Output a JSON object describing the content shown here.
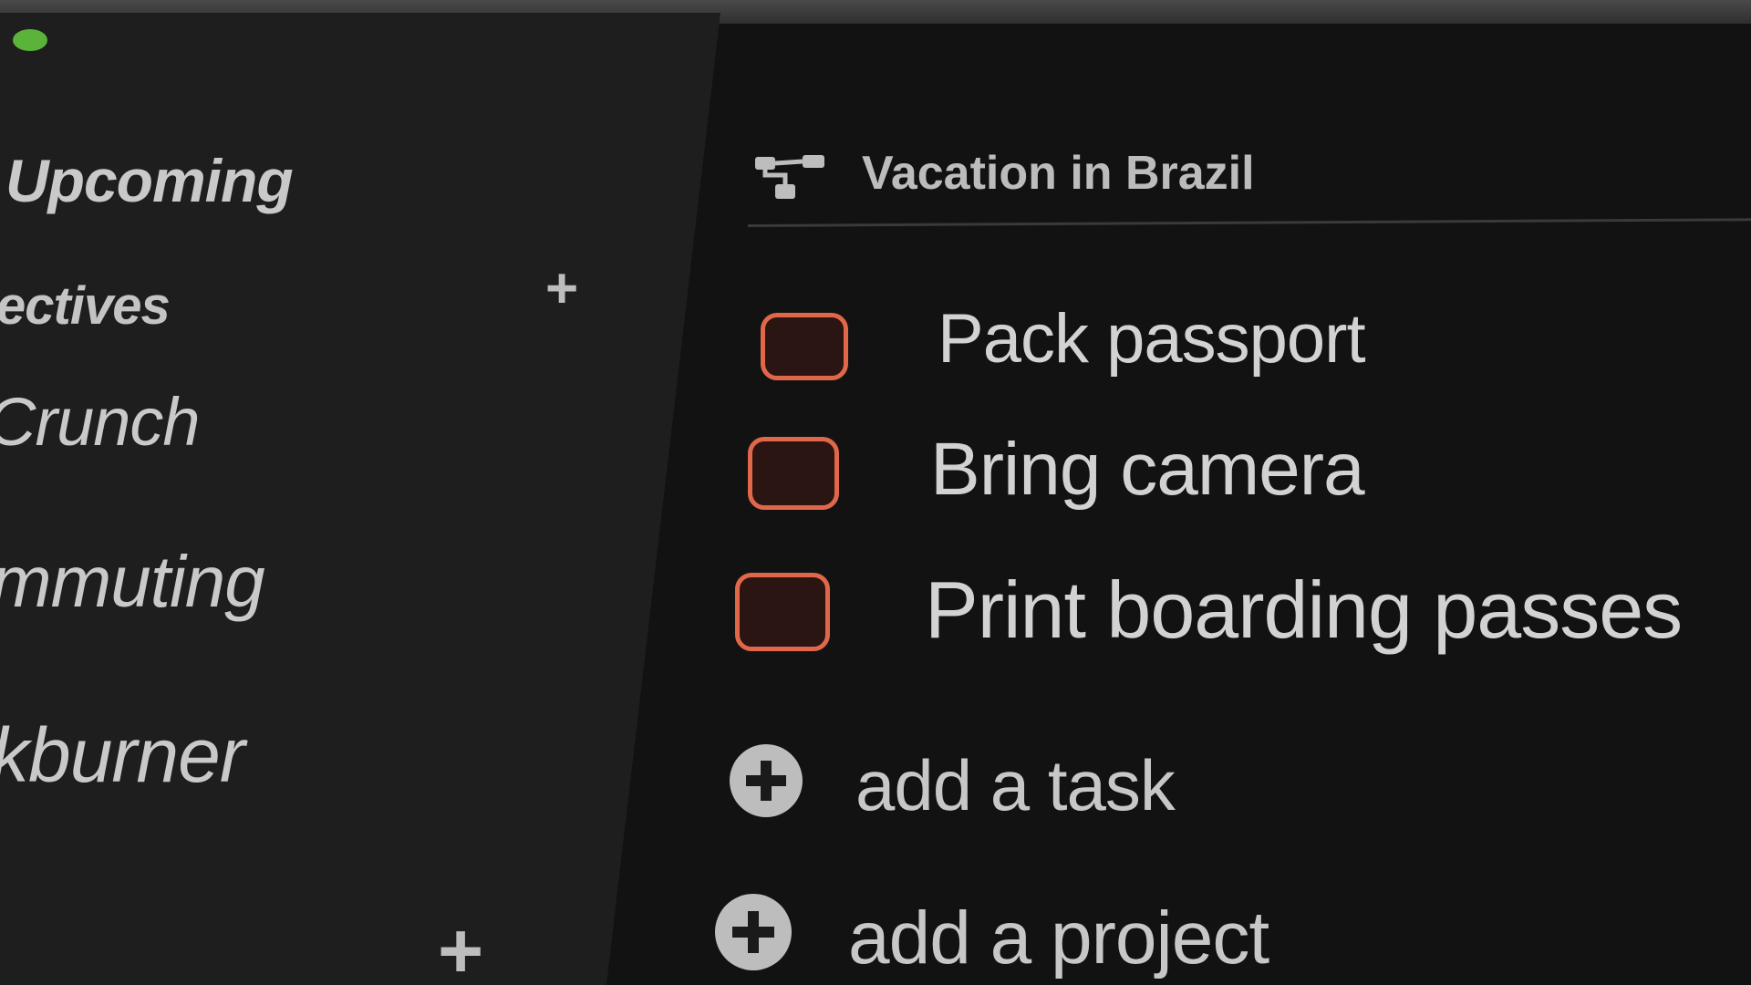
{
  "sidebar": {
    "items": [
      {
        "label": "Upcoming"
      },
      {
        "label": "ectives"
      },
      {
        "label": "Crunch"
      },
      {
        "label": "mmuting"
      },
      {
        "label": "kburner"
      }
    ],
    "add_symbol": "+"
  },
  "project": {
    "title": "Vacation in Brazil",
    "icon": "project-tree-icon"
  },
  "tasks": [
    {
      "label": "Pack passport",
      "checked": false
    },
    {
      "label": "Bring camera",
      "checked": false
    },
    {
      "label": "Print boarding passes",
      "checked": false
    }
  ],
  "actions": {
    "add_task": "add a task",
    "add_project": "add a project"
  },
  "colors": {
    "checkbox_border": "#e0674a",
    "status_dot": "#5bb33a",
    "sidebar_bg": "#1e1e1e",
    "main_bg": "#121212"
  }
}
